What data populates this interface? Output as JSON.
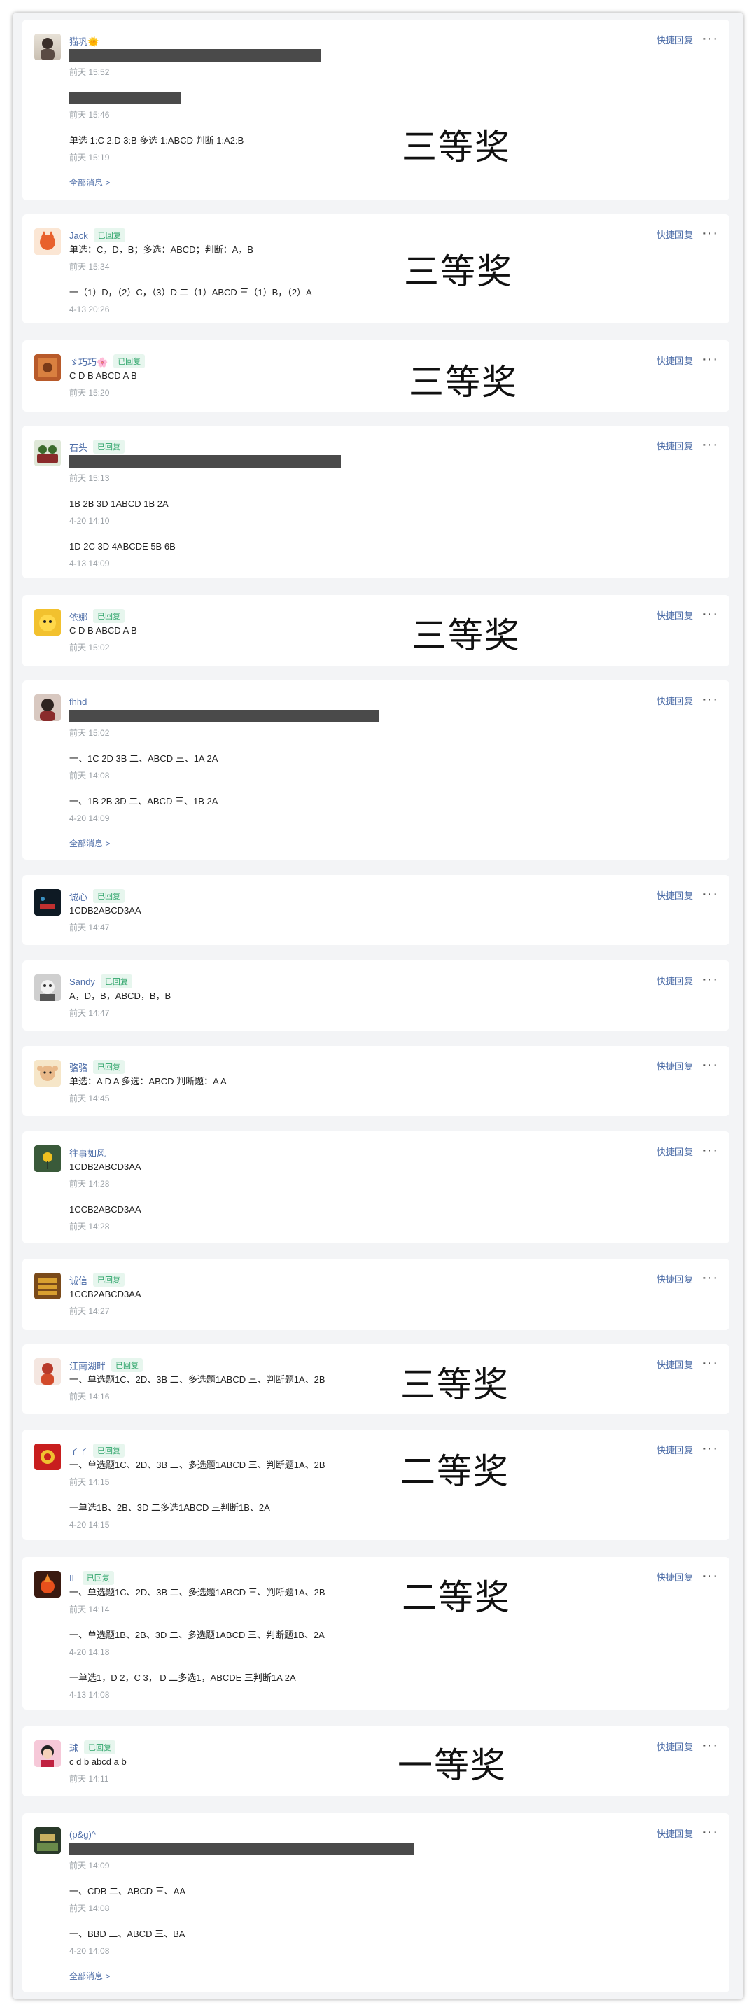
{
  "ui": {
    "quick_reply": "快捷回复",
    "more": "···",
    "all_messages": "全部消息 >",
    "replied_badge": "已回复"
  },
  "prizes": {
    "third": "三等奖",
    "second": "二等奖",
    "first": "一等奖"
  },
  "cards": [
    {
      "name": "猫巩🌞",
      "badge": "",
      "messages": [
        {
          "text": "",
          "time": "前天 15:52"
        },
        {
          "text": "",
          "time": "前天 15:46"
        },
        {
          "text": "单选 1:C 2:D 3:B 多选 1:ABCD 判断 1:A2:B",
          "time": "前天 15:19"
        }
      ],
      "all_messages": true,
      "prize": "三等奖"
    },
    {
      "name": "Jack",
      "badge": "已回复",
      "messages": [
        {
          "text": "单选：C，D，B；多选：ABCD；判断：A，B",
          "time": "前天 15:34"
        },
        {
          "text": "一（1）D，（2）C，（3）D 二（1）ABCD 三（1）B，（2）A",
          "time": "4-13 20:26"
        }
      ],
      "prize": "三等奖"
    },
    {
      "name": "ゞ巧巧🌸",
      "badge": "已回复",
      "messages": [
        {
          "text": "C D B ABCD A B",
          "time": "前天 15:20"
        }
      ],
      "prize": "三等奖"
    },
    {
      "name": "石头",
      "badge": "已回复",
      "messages": [
        {
          "text": "",
          "time": "前天 15:13"
        },
        {
          "text": "1B 2B 3D 1ABCD 1B 2A",
          "time": "4-20 14:10"
        },
        {
          "text": "1D 2C 3D 4ABCDE 5B 6B",
          "time": "4-13 14:09"
        }
      ]
    },
    {
      "name": "依娜",
      "badge": "已回复",
      "messages": [
        {
          "text": "C D B ABCD A B",
          "time": "前天 15:02"
        }
      ],
      "prize": "三等奖"
    },
    {
      "name": "fhhd",
      "badge": "",
      "messages": [
        {
          "text": "",
          "time": "前天 15:02"
        },
        {
          "text": "一、1C 2D 3B 二、ABCD 三、1A 2A",
          "time": "前天 14:08"
        },
        {
          "text": "一、1B 2B 3D 二、ABCD 三、1B 2A",
          "time": "4-20 14:09"
        }
      ],
      "all_messages": true
    },
    {
      "name": "诚心",
      "badge": "已回复",
      "messages": [
        {
          "text": "1CDB2ABCD3AA",
          "time": "前天 14:47"
        }
      ]
    },
    {
      "name": "Sandy",
      "badge": "已回复",
      "messages": [
        {
          "text": "A，D，B，ABCD，B，B",
          "time": "前天 14:47"
        }
      ]
    },
    {
      "name": "骆骆",
      "badge": "已回复",
      "messages": [
        {
          "text": "单选：A D A 多选：ABCD 判断题：A A",
          "time": "前天 14:45"
        }
      ]
    },
    {
      "name": "往事如风",
      "badge": "",
      "messages": [
        {
          "text": "1CDB2ABCD3AA",
          "time": "前天 14:28"
        },
        {
          "text": "1CCB2ABCD3AA",
          "time": "前天 14:28"
        }
      ]
    },
    {
      "name": "诚信",
      "badge": "已回复",
      "messages": [
        {
          "text": "1CCB2ABCD3AA",
          "time": "前天 14:27"
        }
      ]
    },
    {
      "name": "江南湖畔",
      "badge": "已回复",
      "messages": [
        {
          "text": "一、单选题1C、2D、3B 二、多选题1ABCD 三、判断题1A、2B",
          "time": "前天 14:16"
        }
      ],
      "prize": "三等奖"
    },
    {
      "name": "了了",
      "badge": "已回复",
      "messages": [
        {
          "text": "一、单选题1C、2D、3B 二、多选题1ABCD 三、判断题1A、2B",
          "time": "前天 14:15"
        },
        {
          "text": "一单选1B、2B、3D 二多选1ABCD 三判断1B、2A",
          "time": "4-20 14:15"
        }
      ],
      "prize": "二等奖"
    },
    {
      "name": "IL",
      "badge": "已回复",
      "messages": [
        {
          "text": "一、单选题1C、2D、3B 二、多选题1ABCD 三、判断题1A、2B",
          "time": "前天 14:14"
        },
        {
          "text": "一、单选题1B、2B、3D 二、多选题1ABCD 三、判断题1B、2A",
          "time": "4-20 14:18"
        },
        {
          "text": "一单选1，D 2，C 3， D 二多选1，ABCDE 三判断1A 2A",
          "time": "4-13 14:08"
        }
      ],
      "prize": "二等奖"
    },
    {
      "name": "球",
      "badge": "已回复",
      "messages": [
        {
          "text": "c d b abcd a b",
          "time": "前天 14:11"
        }
      ],
      "prize": "一等奖"
    },
    {
      "name": "(p&g)^",
      "badge": "",
      "messages": [
        {
          "text": "",
          "time": "前天 14:09"
        },
        {
          "text": "一、CDB 二、ABCD 三、AA",
          "time": "前天 14:08"
        },
        {
          "text": "一、BBD 二、ABCD 三、BA",
          "time": "4-20 14:08"
        }
      ],
      "all_messages": true
    }
  ]
}
